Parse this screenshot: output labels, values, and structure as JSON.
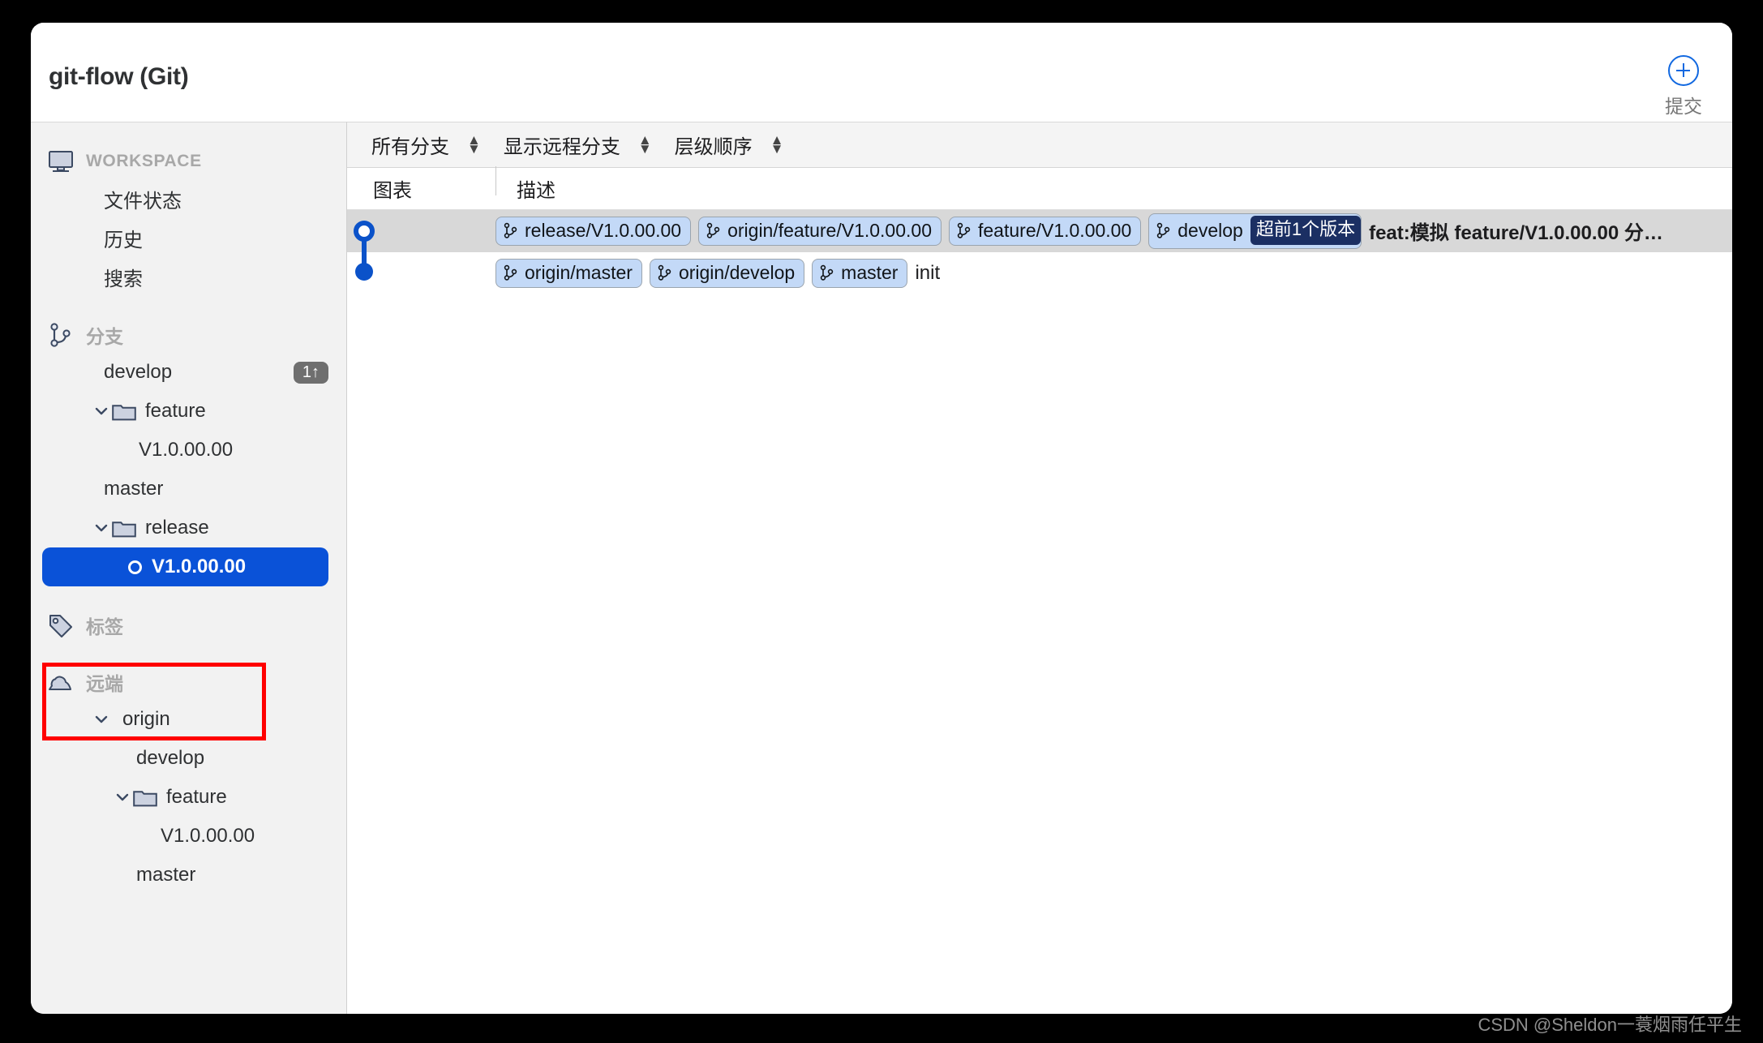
{
  "window": {
    "title": "git-flow (Git)"
  },
  "toolbar": {
    "commit_button_label": "提交",
    "commit_button_icon": "circle-plus-icon"
  },
  "sidebar": {
    "sections": [
      {
        "icon": "monitor-icon",
        "label": "WORKSPACE",
        "items": [
          {
            "label": "文件状态",
            "indent": 1
          },
          {
            "label": "历史",
            "indent": 1
          },
          {
            "label": "搜索",
            "indent": 1
          }
        ]
      },
      {
        "icon": "branch-icon",
        "label": "分支",
        "items": [
          {
            "label": "develop",
            "indent": 1,
            "badge": "1↑"
          },
          {
            "label": "feature",
            "indent": 1,
            "twisty": "chevron-down-icon",
            "folder": true
          },
          {
            "label": "V1.0.00.00",
            "indent": 2
          },
          {
            "label": "master",
            "indent": 1
          },
          {
            "label": "release",
            "indent": 1,
            "twisty": "chevron-down-icon",
            "folder": true
          },
          {
            "label": "V1.0.00.00",
            "indent": 2,
            "selected": true,
            "dot": true
          }
        ]
      },
      {
        "icon": "tag-icon",
        "label": "标签",
        "items": []
      },
      {
        "icon": "cloud-icon",
        "label": "远端",
        "items": [
          {
            "label": "origin",
            "indent": 1,
            "twisty": "chevron-down-icon"
          },
          {
            "label": "develop",
            "indent": 2
          },
          {
            "label": "feature",
            "indent": 2,
            "twisty": "chevron-down-icon",
            "folder": true
          },
          {
            "label": "V1.0.00.00",
            "indent": 3
          },
          {
            "label": "master",
            "indent": 2
          }
        ]
      }
    ],
    "highlight_color": "#ff0000",
    "selection_color": "#0a52d8"
  },
  "filters": [
    {
      "label": "所有分支"
    },
    {
      "label": "显示远程分支"
    },
    {
      "label": "层级顺序"
    }
  ],
  "columns": {
    "graph": "图表",
    "description": "描述"
  },
  "commits": [
    {
      "highlighted": true,
      "node": "open",
      "refs": [
        {
          "label": "release/V1.0.00.00"
        },
        {
          "label": "origin/feature/V1.0.00.00"
        },
        {
          "label": "feature/V1.0.00.00"
        },
        {
          "label": "develop",
          "badge": "超前1个版本"
        }
      ],
      "message": "feat:模拟 feature/V1.0.00.00 分…",
      "bold": true
    },
    {
      "highlighted": false,
      "node": "filled",
      "refs": [
        {
          "label": "origin/master"
        },
        {
          "label": "origin/develop"
        },
        {
          "label": "master"
        }
      ],
      "message": "init",
      "bold": false
    }
  ],
  "watermark": "CSDN @Sheldon一蓑烟雨任平生"
}
